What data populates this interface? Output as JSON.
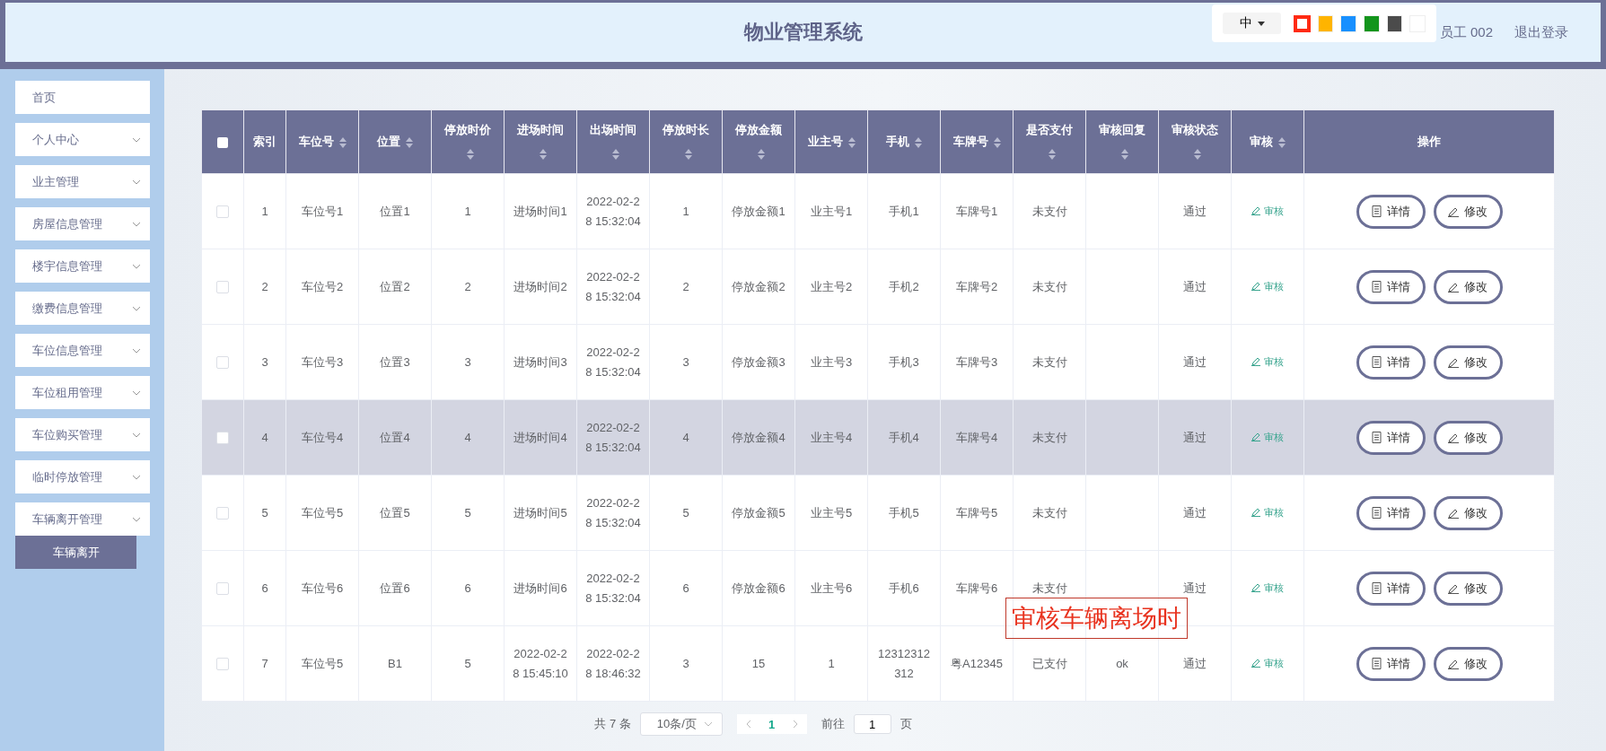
{
  "header": {
    "title": "物业管理系统",
    "user": "员工 002",
    "logout": "退出登录"
  },
  "theme_switcher": {
    "language": "中",
    "colors": [
      {
        "color": "#ff2a12",
        "selected": true
      },
      {
        "color": "#ffb400",
        "selected": false
      },
      {
        "color": "#1890ff",
        "selected": false
      },
      {
        "color": "#13951c",
        "selected": false
      },
      {
        "color": "#4b4b4b",
        "selected": false
      },
      {
        "color": "#ffffff",
        "selected": false
      }
    ]
  },
  "sidebar": {
    "items": [
      {
        "label": "首页",
        "expandable": false
      },
      {
        "label": "个人中心",
        "expandable": true
      },
      {
        "label": "业主管理",
        "expandable": true
      },
      {
        "label": "房屋信息管理",
        "expandable": true
      },
      {
        "label": "楼宇信息管理",
        "expandable": true
      },
      {
        "label": "缴费信息管理",
        "expandable": true
      },
      {
        "label": "车位信息管理",
        "expandable": true
      },
      {
        "label": "车位租用管理",
        "expandable": true
      },
      {
        "label": "车位购买管理",
        "expandable": true
      },
      {
        "label": "临时停放管理",
        "expandable": true
      },
      {
        "label": "车辆离开管理",
        "expandable": true
      }
    ],
    "submenu": [
      {
        "label": "车辆离开"
      }
    ]
  },
  "table": {
    "select_all": {
      "checked": false
    },
    "columns": [
      {
        "label": "索引",
        "sortable": false
      },
      {
        "label": "车位号",
        "sortable": true
      },
      {
        "label": "位置",
        "sortable": true
      },
      {
        "label": "停放时价",
        "sortable": true
      },
      {
        "label": "进场时间",
        "sortable": true
      },
      {
        "label": "出场时间",
        "sortable": true
      },
      {
        "label": "停放时长",
        "sortable": true
      },
      {
        "label": "停放金额",
        "sortable": true
      },
      {
        "label": "业主号",
        "sortable": true
      },
      {
        "label": "手机",
        "sortable": true
      },
      {
        "label": "车牌号",
        "sortable": true
      },
      {
        "label": "是否支付",
        "sortable": true
      },
      {
        "label": "审核回复",
        "sortable": true
      },
      {
        "label": "审核状态",
        "sortable": true
      },
      {
        "label": "审核",
        "sortable": true
      },
      {
        "label": "操作",
        "sortable": false
      }
    ],
    "rows": [
      {
        "checked": false,
        "highlighted": false,
        "cells": [
          "1",
          "车位号1",
          "位置1",
          "1",
          "进场时间1",
          "2022-02-28 15:32:04",
          "1",
          "停放金额1",
          "业主号1",
          "手机1",
          "车牌号1",
          "未支付",
          "",
          "通过"
        ],
        "audit": "审核",
        "actions": [
          "详情",
          "修改"
        ]
      },
      {
        "checked": false,
        "highlighted": false,
        "cells": [
          "2",
          "车位号2",
          "位置2",
          "2",
          "进场时间2",
          "2022-02-28 15:32:04",
          "2",
          "停放金额2",
          "业主号2",
          "手机2",
          "车牌号2",
          "未支付",
          "",
          "通过"
        ],
        "audit": "审核",
        "actions": [
          "详情",
          "修改"
        ]
      },
      {
        "checked": false,
        "highlighted": false,
        "cells": [
          "3",
          "车位号3",
          "位置3",
          "3",
          "进场时间3",
          "2022-02-28 15:32:04",
          "3",
          "停放金额3",
          "业主号3",
          "手机3",
          "车牌号3",
          "未支付",
          "",
          "通过"
        ],
        "audit": "审核",
        "actions": [
          "详情",
          "修改"
        ]
      },
      {
        "checked": false,
        "highlighted": true,
        "cells": [
          "4",
          "车位号4",
          "位置4",
          "4",
          "进场时间4",
          "2022-02-28 15:32:04",
          "4",
          "停放金额4",
          "业主号4",
          "手机4",
          "车牌号4",
          "未支付",
          "",
          "通过"
        ],
        "audit": "审核",
        "actions": [
          "详情",
          "修改"
        ]
      },
      {
        "checked": false,
        "highlighted": false,
        "cells": [
          "5",
          "车位号5",
          "位置5",
          "5",
          "进场时间5",
          "2022-02-28 15:32:04",
          "5",
          "停放金额5",
          "业主号5",
          "手机5",
          "车牌号5",
          "未支付",
          "",
          "通过"
        ],
        "audit": "审核",
        "actions": [
          "详情",
          "修改"
        ]
      },
      {
        "checked": false,
        "highlighted": false,
        "cells": [
          "6",
          "车位号6",
          "位置6",
          "6",
          "进场时间6",
          "2022-02-28 15:32:04",
          "6",
          "停放金额6",
          "业主号6",
          "手机6",
          "车牌号6",
          "未支付",
          "",
          "通过"
        ],
        "audit": "审核",
        "actions": [
          "详情",
          "修改"
        ]
      },
      {
        "checked": false,
        "highlighted": false,
        "cells": [
          "7",
          "车位号5",
          "B1",
          "5",
          "2022-02-28 15:45:10",
          "2022-02-28 18:46:32",
          "3",
          "15",
          "1",
          "12312312312",
          "粤A12345",
          "已支付",
          "ok",
          "通过"
        ],
        "audit": "审核",
        "actions": [
          "详情",
          "修改"
        ]
      }
    ]
  },
  "pagination": {
    "total": "共 7 条",
    "page_size": "10条/页",
    "pages": [
      {
        "label": "1",
        "selected": true
      }
    ],
    "goto_label": "前往",
    "goto_value": "1",
    "goto_unit": "页"
  },
  "annotation": {
    "text": "审核车辆离场时"
  }
}
